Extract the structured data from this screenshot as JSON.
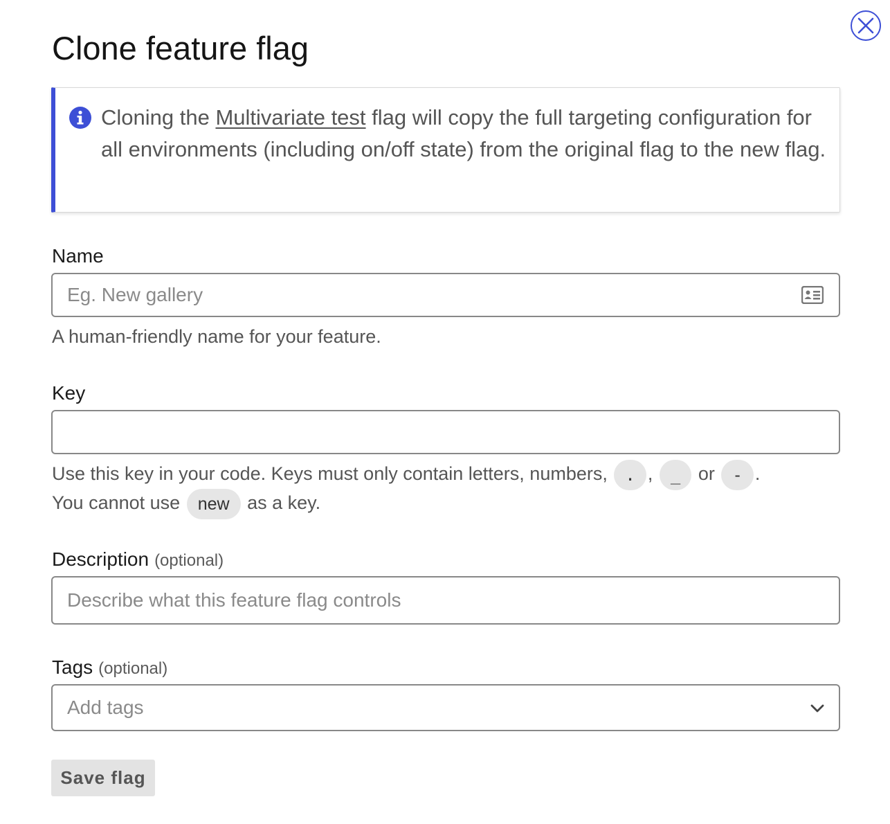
{
  "dialog": {
    "title": "Clone feature flag",
    "close_icon": "close-icon"
  },
  "callout": {
    "icon": "info-icon",
    "text_before": "Cloning the ",
    "flag_name": "Multivariate test",
    "text_after": " flag will copy the full targeting configuration for all environments (including on/off state) from the original flag to the new flag.",
    "accent_color": "#3d4fd6"
  },
  "name_field": {
    "label": "Name",
    "placeholder": "Eg. New gallery",
    "value": "",
    "hint": "A human-friendly name for your feature.",
    "icon": "contact-card-icon"
  },
  "key_field": {
    "label": "Key",
    "value": "",
    "hint_part1": "Use this key in your code. Keys must only contain letters, numbers,",
    "chip_dot": ".",
    "comma": ",",
    "chip_underscore": "_",
    "or": "or",
    "chip_dash": "-",
    "period": ".",
    "hint_part2": "You cannot use",
    "chip_new": "new",
    "hint_part3": "as a key."
  },
  "description_field": {
    "label": "Description",
    "optional": "(optional)",
    "placeholder": "Describe what this feature flag controls",
    "value": ""
  },
  "tags_field": {
    "label": "Tags",
    "optional": "(optional)",
    "placeholder": "Add tags",
    "icon": "chevron-down-icon"
  },
  "actions": {
    "save_label": "Save flag"
  }
}
